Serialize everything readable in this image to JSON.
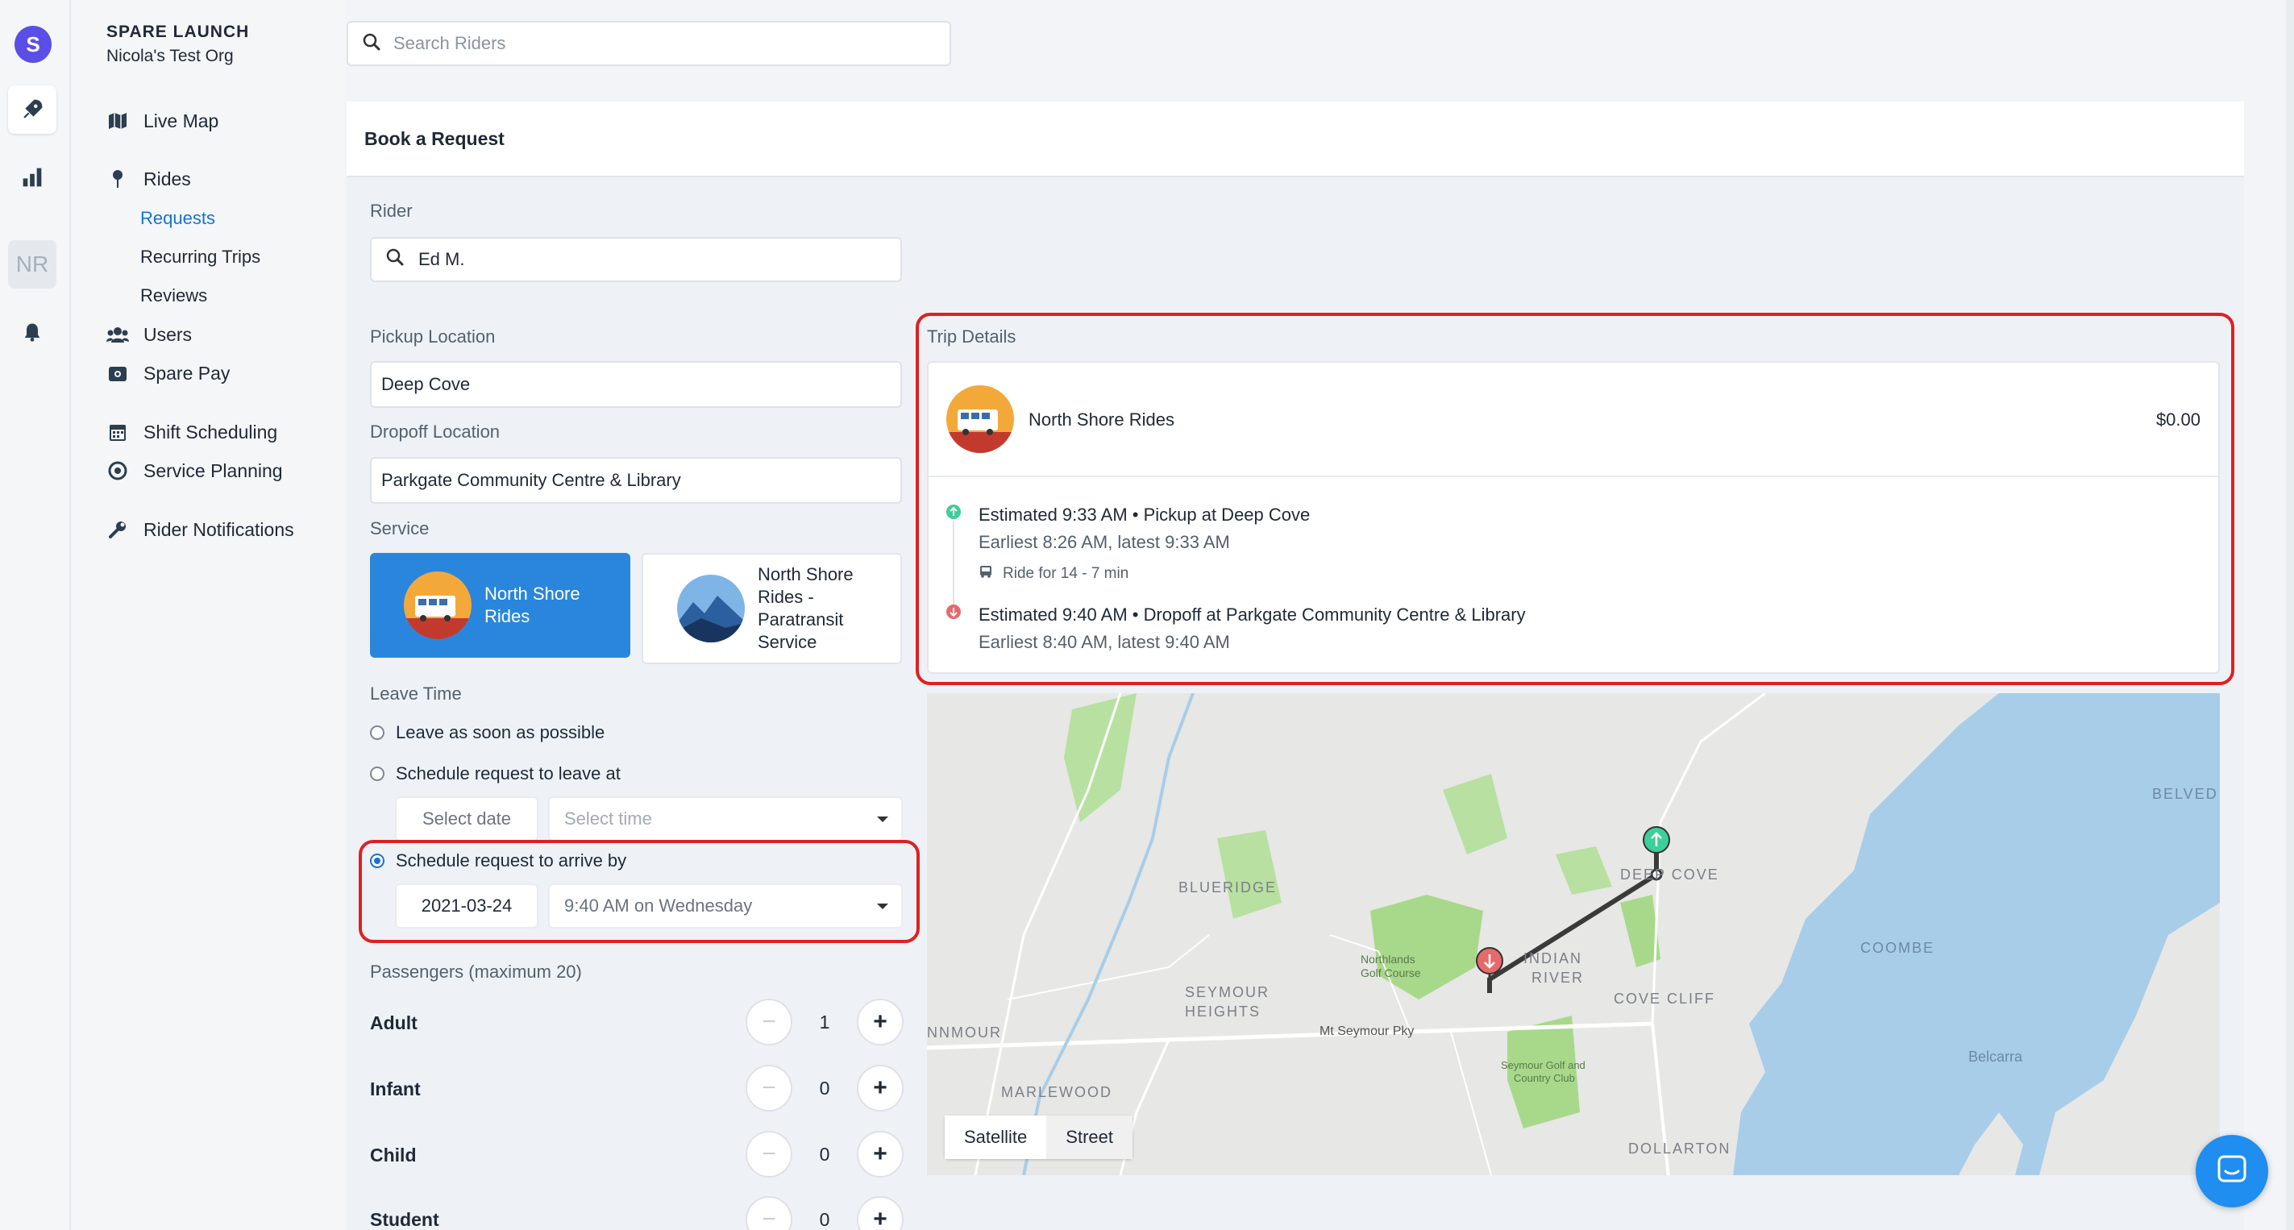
{
  "rail": {
    "logo_letter": "S",
    "nr_label": "NR"
  },
  "org": {
    "title": "SPARE LAUNCH",
    "subtitle": "Nicola's Test Org"
  },
  "search": {
    "placeholder": "Search Riders"
  },
  "nav": {
    "live_map": "Live Map",
    "rides": "Rides",
    "requests": "Requests",
    "recurring_trips": "Recurring Trips",
    "reviews": "Reviews",
    "users": "Users",
    "spare_pay": "Spare Pay",
    "shift_scheduling": "Shift Scheduling",
    "service_planning": "Service Planning",
    "rider_notifications": "Rider Notifications"
  },
  "form": {
    "header": "Book a Request",
    "rider_label": "Rider",
    "rider_value": "Ed M.",
    "pickup_label": "Pickup Location",
    "pickup_value": "Deep Cove",
    "dropoff_label": "Dropoff Location",
    "dropoff_value": "Parkgate Community Centre & Library",
    "service_label": "Service",
    "services": [
      {
        "label": "North Shore Rides",
        "selected": true
      },
      {
        "label": "North Shore Rides - Paratransit Service",
        "selected": false
      }
    ],
    "leave_time_label": "Leave Time",
    "opt_asap": "Leave as soon as possible",
    "opt_leave_at": "Schedule request to leave at",
    "select_date_placeholder": "Select date",
    "select_time_placeholder": "Select time",
    "opt_arrive_by": "Schedule request to arrive by",
    "arrive_date": "2021-03-24",
    "arrive_time": "9:40 AM on Wednesday",
    "passengers_label": "Passengers (maximum 20)",
    "passengers": [
      {
        "label": "Adult",
        "count": "1"
      },
      {
        "label": "Infant",
        "count": "0"
      },
      {
        "label": "Child",
        "count": "0"
      },
      {
        "label": "Student",
        "count": "0"
      }
    ]
  },
  "trip": {
    "label": "Trip Details",
    "service_name": "North Shore Rides",
    "price": "$0.00",
    "pickup_line": "Estimated 9:33 AM • Pickup at Deep Cove",
    "pickup_window": "Earliest 8:26 AM, latest 9:33 AM",
    "ride_duration": "Ride for 14 - 7 min",
    "dropoff_line": "Estimated 9:40 AM • Dropoff at Parkgate Community Centre & Library",
    "dropoff_window": "Earliest 8:40 AM, latest 9:40 AM"
  },
  "map": {
    "tab_satellite": "Satellite",
    "tab_street": "Street",
    "places": {
      "blueridge": "BLUERIDGE",
      "seymour_heights": "SEYMOUR HEIGHTS",
      "northlands": "Northlands Golf Course",
      "indian_river": "INDIAN RIVER",
      "deep_cove": "DEEP COVE",
      "cove_cliff": "COVE CLIFF",
      "coombe": "COOMBE",
      "belcarra": "Belcarra",
      "belved": "BELVED",
      "seymour_golf": "Seymour Golf and Country Club",
      "dollarton": "DOLLARTON",
      "marlewood": "MARLEWOOD",
      "nnmour": "NNMOUR",
      "mt_seymour_pky": "Mt Seymour Pky"
    }
  },
  "colors": {
    "accent": "#1673d1",
    "selected_service": "#2a86dc",
    "highlight_box": "#e02020",
    "pickup_marker": "#3ccf9a",
    "dropoff_marker": "#e66a6a"
  }
}
